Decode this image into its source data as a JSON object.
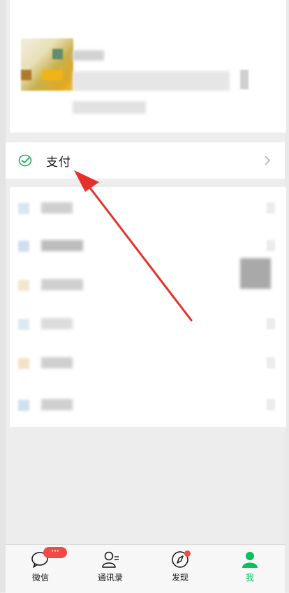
{
  "payment": {
    "label": "支付"
  },
  "tabs": [
    {
      "label": "微信",
      "icon": "chat-icon",
      "badge": "···"
    },
    {
      "label": "通讯录",
      "icon": "contacts-icon"
    },
    {
      "label": "发现",
      "icon": "compass-icon"
    },
    {
      "label": "我",
      "icon": "me-icon",
      "active": true
    }
  ],
  "colors": {
    "accent": "#07c160",
    "annotation": "#e8302a",
    "badge": "#f04a48"
  }
}
